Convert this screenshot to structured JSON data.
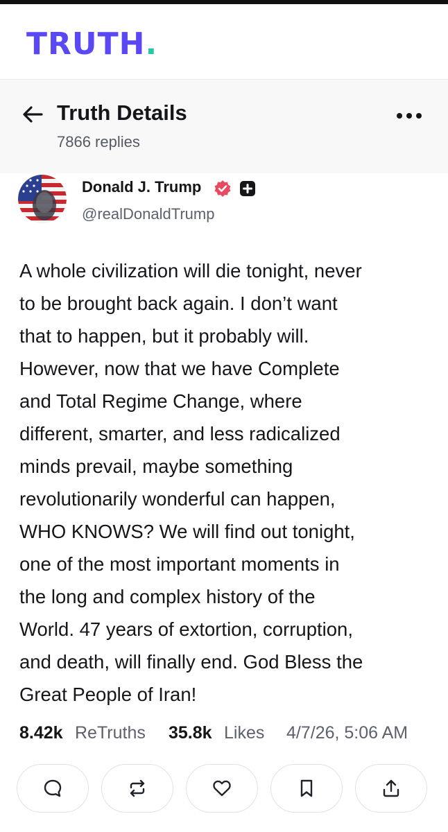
{
  "brand": {
    "logo_text": "TRUTH",
    "logo_dot": ".",
    "logo_color": "#5a48f5",
    "dot_color": "#29c7a5"
  },
  "header": {
    "back_icon": "arrow-left-icon",
    "title": "Truth Details",
    "replies": "7866 replies",
    "more_icon": "ellipsis-horizontal-icon"
  },
  "author": {
    "name": "Donald J. Trump",
    "handle": "@realDonaldTrump",
    "verified_icon": "verified-badge-icon",
    "verified_color": "#e84a5f",
    "plus_icon": "plus-badge-icon"
  },
  "post": {
    "lines": [
      "A whole civilization will die tonight, never",
      "to be brought back again. I don’t want",
      "that to happen, but it probably will.",
      "However, now that we have Complete",
      "and Total Regime Change, where",
      "different, smarter, and less radicalized",
      "minds prevail, maybe something",
      "revolutionarily wonderful can happen,",
      "WHO KNOWS? We will find out tonight,",
      "one of the most important moments in",
      "the long and complex history of the",
      "World. 47 years of extortion, corruption,",
      "and death, will finally end. God Bless the",
      "Great People of Iran!"
    ]
  },
  "stats": {
    "retruths_count": "8.42k",
    "retruths_label": "ReTruths",
    "likes_count": "35.8k",
    "likes_label": "Likes",
    "timestamp": "4/7/26, 5:06 AM"
  },
  "actions": [
    {
      "icon": "reply-icon"
    },
    {
      "icon": "retruth-icon"
    },
    {
      "icon": "heart-icon"
    },
    {
      "icon": "bookmark-icon"
    },
    {
      "icon": "share-icon"
    }
  ]
}
